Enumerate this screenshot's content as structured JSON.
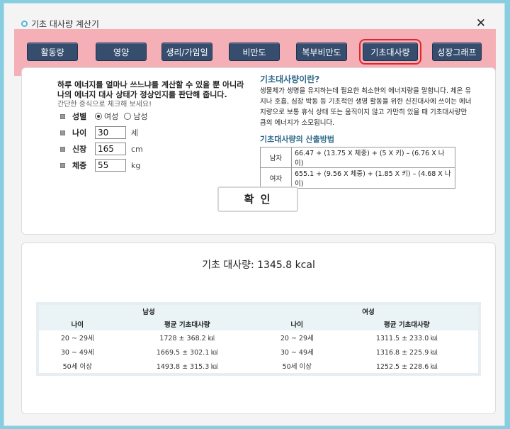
{
  "window": {
    "title": "기초 대사량 계산기",
    "close": "✕"
  },
  "tabs": [
    {
      "label": "활동량"
    },
    {
      "label": "영양"
    },
    {
      "label": "생리/가임일"
    },
    {
      "label": "비만도"
    },
    {
      "label": "복부비만도"
    },
    {
      "label": "기초대사량",
      "selected": true
    },
    {
      "label": "성장그래프"
    }
  ],
  "intro": {
    "line1": "하루 에너지를 얼마나 쓰느냐를 계산할 수 있을 뿐 아니라",
    "line2": "나의 에너지 대사 상태가 정상인지를 판단해 줍니다.",
    "line3": "간단한 증식으로 체크해 보세요!"
  },
  "form": {
    "gender": {
      "label": "성별",
      "options": [
        "여성",
        "남성"
      ],
      "selected": "여성"
    },
    "age": {
      "label": "나이",
      "value": "30",
      "unit": "세"
    },
    "height": {
      "label": "신장",
      "value": "165",
      "unit": "cm"
    },
    "weight": {
      "label": "체중",
      "value": "55",
      "unit": "kg"
    }
  },
  "info": {
    "title": "기초대사량이란?",
    "paragraph": "생물체가 생명을 유지하는데 필요한 최소한의 에너지량을 말합니다. 체온 유지나 호흡, 심장 박동 등 기초적인 생명 활동을 위한 신진대사에 쓰이는 에너지량으로 보통 휴식 상태 또는 움직이지 않고 가만히 있을 때 기초대사량만큼의 에너지가 소모됩니다.",
    "method_title": "기초대사량의 산출방법",
    "formulas": [
      {
        "gender": "남자",
        "formula": "66.47 + (13.75 X 체중) + (5 X 키) – (6.76 X 나이)"
      },
      {
        "gender": "여자",
        "formula": "655.1 + (9.56 X 체중) + (1.85 X 키) – (4.68 X 나이)"
      }
    ]
  },
  "confirm_label": "확 인",
  "result": "기초 대사량: 1345.8 kcal",
  "reference": {
    "male_header": "남성",
    "female_header": "여성",
    "age_header": "나이",
    "avg_header": "평균 기초대사량",
    "rows": [
      {
        "age": "20 ~ 29세",
        "male": "1728 ± 368.2 ㎉",
        "female": "1311.5 ± 233.0 ㎉"
      },
      {
        "age": "30 ~ 49세",
        "male": "1669.5 ± 302.1 ㎉",
        "female": "1316.8 ± 225.9 ㎉"
      },
      {
        "age": "50세 이상",
        "male": "1493.8 ± 315.3 ㎉",
        "female": "1252.5 ± 228.6 ㎉"
      }
    ]
  },
  "colors": {
    "tab": "#364d6e",
    "highlight_band": "#f596a0",
    "selected_outline": "#e0262c",
    "accent_text": "#2f6a8a"
  }
}
